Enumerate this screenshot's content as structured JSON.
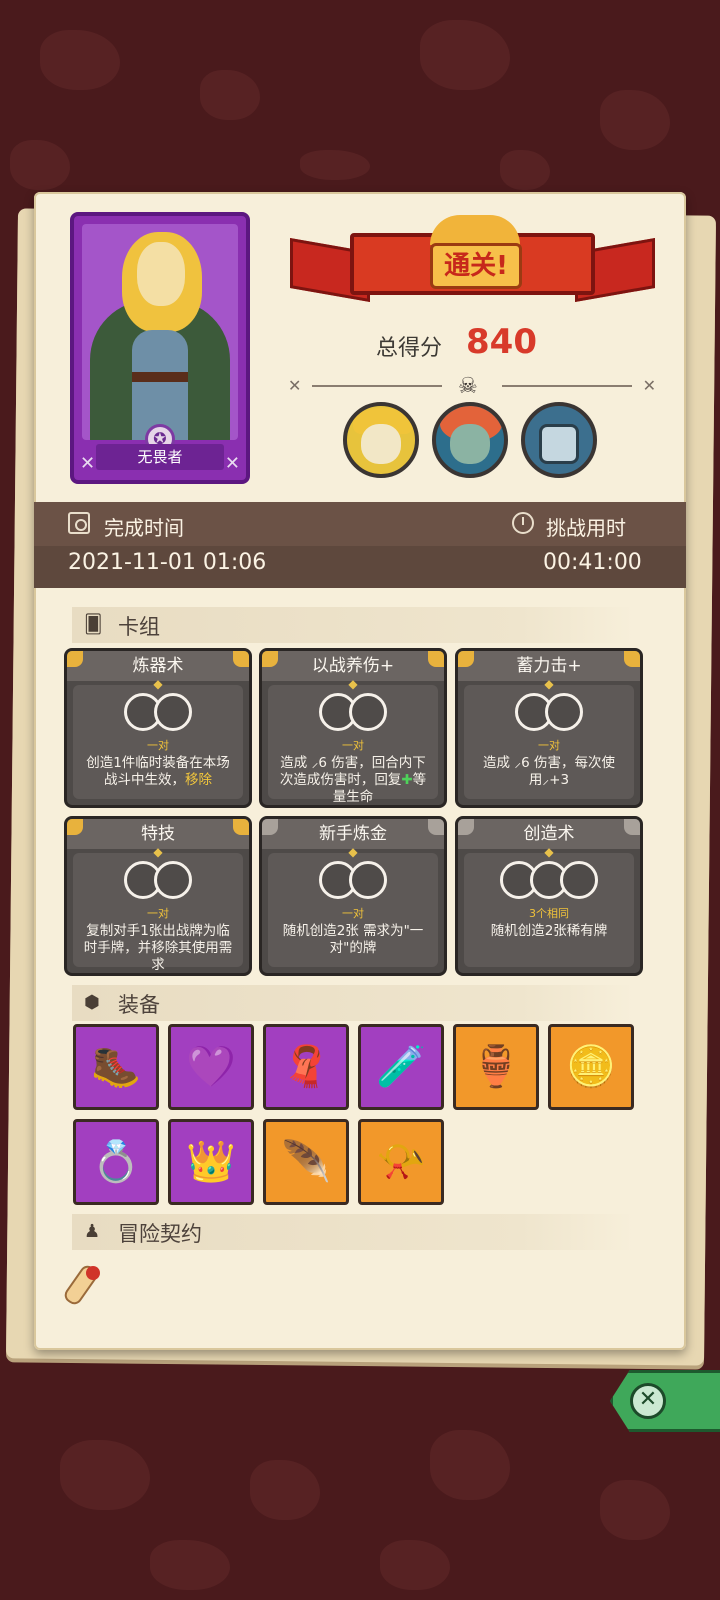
{
  "hero": {
    "name": "无畏者",
    "badge_icon": "star-emblem-icon"
  },
  "banner": {
    "title": "通关!"
  },
  "score": {
    "label": "总得分",
    "value": "840"
  },
  "bosses": [
    {
      "name": "boss-witch",
      "icon": "witch-portrait"
    },
    {
      "name": "boss-orc",
      "icon": "orc-portrait"
    },
    {
      "name": "boss-knight",
      "icon": "knight-portrait"
    }
  ],
  "time": {
    "completion_label": "完成时间",
    "completion_value": "2021-11-01 01:06",
    "challenge_label": "挑战用时",
    "challenge_value": "00:41:00"
  },
  "deck": {
    "title": "卡组",
    "cards": [
      {
        "title": "炼器术",
        "req": "一对",
        "desc": "创造1件临时装备在本场战斗中生效，",
        "highlight": "移除",
        "gold": true
      },
      {
        "title": "以战养伤+",
        "req": "一对",
        "desc_a": "造成 ⸝6 伤害，回合内下次造成伤害时，回复",
        "plus": "✚",
        "desc_b": "等量生命",
        "gold": true
      },
      {
        "title": "蓄力击+",
        "req": "一对",
        "desc": "造成 ⸝6 伤害，每次使用⸝+3",
        "gold": true
      },
      {
        "title": "特技",
        "req": "一对",
        "desc": "复制对手1张出战牌为临时手牌，并移除其使用需求",
        "gold": true
      },
      {
        "title": "新手炼金",
        "req": "一对",
        "desc": "随机创造2张 需求为\"一对\"的牌",
        "gold": false
      },
      {
        "title": "创造术",
        "req": "3个相同",
        "desc": "随机创造2张稀有牌",
        "gold": false
      }
    ]
  },
  "equipment": {
    "title": "装备",
    "items": [
      {
        "name": "leather-bracer",
        "rarity": "purple",
        "glyph": "🥾"
      },
      {
        "name": "heart-amulet",
        "rarity": "purple",
        "glyph": "💜"
      },
      {
        "name": "red-cloak",
        "rarity": "purple",
        "glyph": "🧣"
      },
      {
        "name": "purple-potion",
        "rarity": "purple",
        "glyph": "🧪"
      },
      {
        "name": "crystal-jar",
        "rarity": "orange",
        "glyph": "🏺"
      },
      {
        "name": "gold-ring-disc",
        "rarity": "orange",
        "glyph": "🪙"
      },
      {
        "name": "diamond-ring",
        "rarity": "purple",
        "glyph": "💍"
      },
      {
        "name": "crown",
        "rarity": "purple",
        "glyph": "👑"
      },
      {
        "name": "phoenix-feather",
        "rarity": "orange",
        "glyph": "🪶"
      },
      {
        "name": "horn",
        "rarity": "orange",
        "glyph": "📯"
      }
    ]
  },
  "contract": {
    "title": "冒险契约"
  },
  "colors": {
    "purple": "#a23fc0",
    "orange": "#f2982a",
    "accent_red": "#d83a2a",
    "close_green": "#3fa85a"
  }
}
